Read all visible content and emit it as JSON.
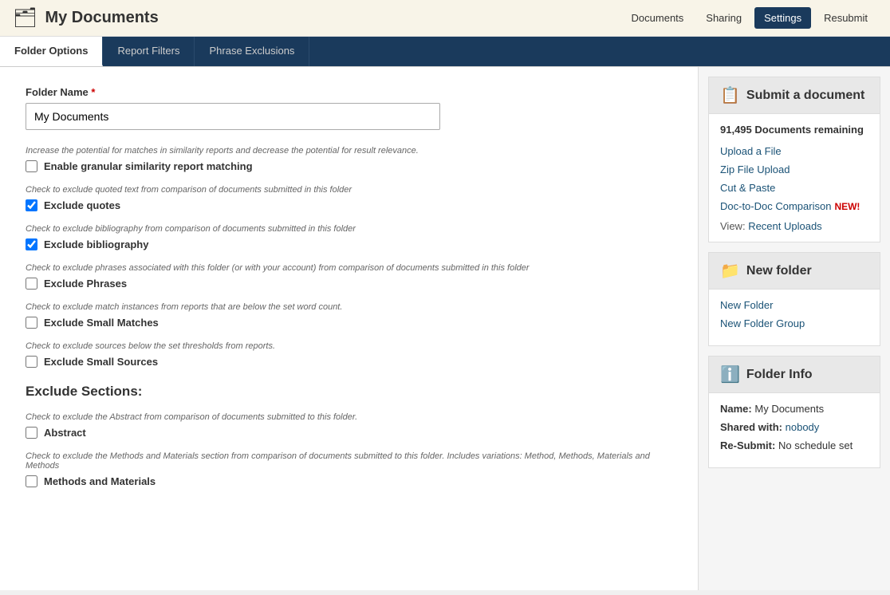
{
  "header": {
    "icon": "📁",
    "title": "My Documents",
    "nav": [
      {
        "label": "Documents",
        "active": false
      },
      {
        "label": "Sharing",
        "active": false
      },
      {
        "label": "Settings",
        "active": true
      },
      {
        "label": "Resubmit",
        "active": false
      }
    ]
  },
  "tabs": [
    {
      "label": "Folder Options",
      "active": true
    },
    {
      "label": "Report Filters",
      "active": false
    },
    {
      "label": "Phrase Exclusions",
      "active": false
    }
  ],
  "main": {
    "folder_name_label": "Folder Name",
    "folder_name_required": "*",
    "folder_name_value": "My Documents",
    "hint_granular": "Increase the potential for matches in similarity reports and decrease the potential for result relevance.",
    "label_granular": "Enable granular similarity report matching",
    "hint_quotes": "Check to exclude quoted text from comparison of documents submitted in this folder",
    "label_quotes": "Exclude quotes",
    "hint_bibliography": "Check to exclude bibliography from comparison of documents submitted in this folder",
    "label_bibliography": "Exclude bibliography",
    "hint_phrases": "Check to exclude phrases associated with this folder (or with your account) from comparison of documents submitted in this folder",
    "label_phrases": "Exclude Phrases",
    "hint_small_matches": "Check to exclude match instances from reports that are below the set word count.",
    "label_small_matches": "Exclude Small Matches",
    "hint_small_sources": "Check to exclude sources below the set thresholds from reports.",
    "label_small_sources": "Exclude Small Sources",
    "section_title": "Exclude Sections:",
    "hint_abstract": "Check to exclude the Abstract from comparison of documents submitted to this folder.",
    "label_abstract": "Abstract",
    "hint_methods": "Check to exclude the Methods and Materials section from comparison of documents submitted to this folder. Includes variations: Method, Methods, Materials and Methods",
    "label_methods": "Methods and Materials"
  },
  "sidebar": {
    "submit": {
      "icon": "📋",
      "title": "Submit a document",
      "count": "91,495 Documents remaining",
      "links": [
        {
          "label": "Upload a File",
          "badge": ""
        },
        {
          "label": "Zip File Upload",
          "badge": ""
        },
        {
          "label": "Cut & Paste",
          "badge": ""
        },
        {
          "label": "Doc-to-Doc Comparison",
          "badge": "NEW!"
        }
      ],
      "view_label": "View:",
      "view_link": "Recent Uploads"
    },
    "new_folder": {
      "icon": "📁",
      "title": "New folder",
      "links": [
        {
          "label": "New Folder"
        },
        {
          "label": "New Folder Group"
        }
      ]
    },
    "folder_info": {
      "icon": "ℹ️",
      "title": "Folder Info",
      "name_label": "Name:",
      "name_value": "My Documents",
      "shared_label": "Shared with:",
      "shared_value": "nobody",
      "resubmit_label": "Re-Submit:",
      "resubmit_value": "No schedule set"
    }
  }
}
